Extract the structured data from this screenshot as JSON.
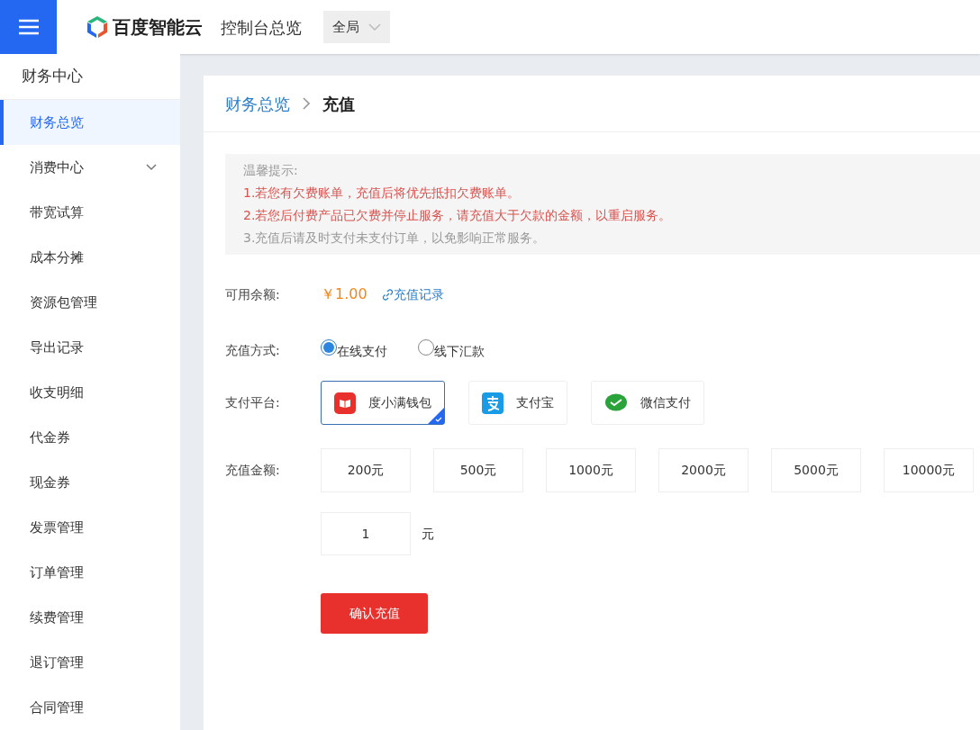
{
  "header": {
    "brand": "百度智能云",
    "nav_title": "控制台总览",
    "scope": "全局"
  },
  "sidebar": {
    "title": "财务中心",
    "items": [
      {
        "label": "财务总览",
        "selected": true
      },
      {
        "label": "消费中心",
        "selected": false,
        "expanded": false
      },
      {
        "label": "带宽试算",
        "selected": false
      },
      {
        "label": "成本分摊",
        "selected": false
      },
      {
        "label": "资源包管理",
        "selected": false
      },
      {
        "label": "导出记录",
        "selected": false
      },
      {
        "label": "收支明细",
        "selected": false
      },
      {
        "label": "代金券",
        "selected": false
      },
      {
        "label": "现金券",
        "selected": false
      },
      {
        "label": "发票管理",
        "selected": false
      },
      {
        "label": "订单管理",
        "selected": false
      },
      {
        "label": "续费管理",
        "selected": false
      },
      {
        "label": "退订管理",
        "selected": false
      },
      {
        "label": "合同管理",
        "selected": false
      }
    ]
  },
  "breadcrumb": [
    {
      "label": "财务总览",
      "current": false
    },
    {
      "label": "充值",
      "current": true
    }
  ],
  "notice": {
    "title": "温馨提示:",
    "lines": [
      {
        "kind": "warn",
        "text": "1.若您有欠费账单，充值后将优先抵扣欠费账单。"
      },
      {
        "kind": "warn",
        "text": "2.若您后付费产品已欠费并停止服务，请充值大于欠款的金额，以重启服务。"
      },
      {
        "kind": "info",
        "text": "3.充值后请及时支付未支付订单，以免影响正常服务。"
      }
    ]
  },
  "balance": {
    "label": "可用余额:",
    "amount": "￥1.00",
    "link": "充值记录"
  },
  "method": {
    "label": "充值方式:",
    "options": [
      {
        "label": "在线支付",
        "selected": true
      },
      {
        "label": "线下汇款",
        "selected": false
      }
    ]
  },
  "platform": {
    "label": "支付平台:",
    "options": [
      {
        "kind": "wallet",
        "label": "度小满钱包",
        "selected": true
      },
      {
        "kind": "alipay",
        "label": "支付宝",
        "selected": false
      },
      {
        "kind": "wechat",
        "label": "微信支付",
        "selected": false
      }
    ]
  },
  "amount": {
    "label": "充值金额:",
    "options": [
      {
        "label": "200元",
        "selected": false
      },
      {
        "label": "500元",
        "selected": false
      },
      {
        "label": "1000元",
        "selected": false
      },
      {
        "label": "2000元",
        "selected": false
      },
      {
        "label": "5000元",
        "selected": false
      },
      {
        "label": "10000元",
        "selected": false
      }
    ],
    "custom_value": "1",
    "unit": "元"
  },
  "submit": "确认充值"
}
